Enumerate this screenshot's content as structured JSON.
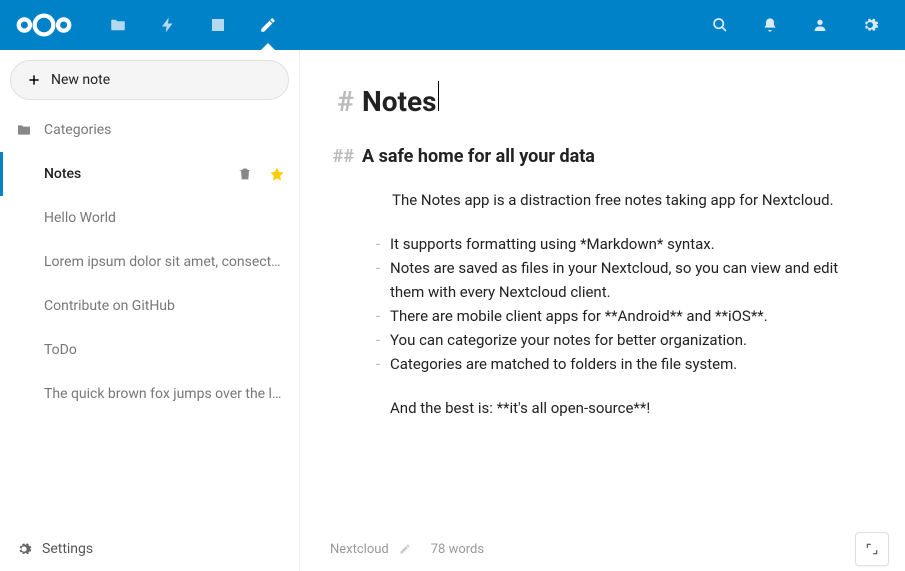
{
  "topbar": {
    "apps": [
      {
        "name": "files-app",
        "icon": "folder"
      },
      {
        "name": "activity-app",
        "icon": "bolt"
      },
      {
        "name": "gallery-app",
        "icon": "picture"
      },
      {
        "name": "notes-app",
        "icon": "edit",
        "active": true
      }
    ],
    "right_icons": [
      {
        "name": "search-icon",
        "icon": "search"
      },
      {
        "name": "notifications-icon",
        "icon": "bell"
      },
      {
        "name": "contacts-icon",
        "icon": "person"
      },
      {
        "name": "settings-icon",
        "icon": "gear"
      }
    ]
  },
  "sidebar": {
    "new_note_label": "New note",
    "categories_label": "Categories",
    "notes": [
      {
        "title": "Notes",
        "active": true,
        "starred": true
      },
      {
        "title": "Hello World"
      },
      {
        "title": "Lorem ipsum dolor sit amet, consectetur ..."
      },
      {
        "title": "Contribute on GitHub"
      },
      {
        "title": "ToDo"
      },
      {
        "title": "The quick brown fox jumps over the loazy..."
      }
    ],
    "settings_label": "Settings"
  },
  "editor": {
    "title": "Notes",
    "subtitle": "A safe home for all your data",
    "intro": "The Notes app is a distraction free notes taking app for Nextcloud.",
    "bullets": [
      "It supports formatting using *Markdown* syntax.",
      "Notes are saved as files in your Nextcloud, so you can view and edit them with every Nextcloud client.",
      "There are mobile client apps for **Android** and **iOS**.",
      "You can categorize your notes for better organization.",
      "Categories are matched to folders in the file system."
    ],
    "outro": "And the best is: **it's all open-source**!"
  },
  "statusbar": {
    "category": "Nextcloud",
    "wordcount": "78 words"
  }
}
